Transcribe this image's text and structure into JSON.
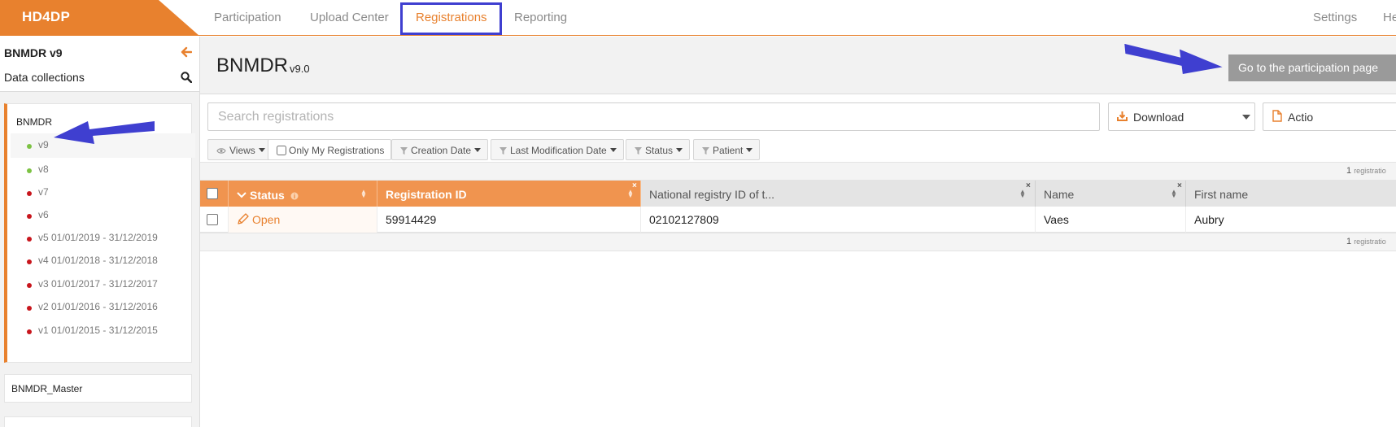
{
  "app": {
    "logo": "HD4DP"
  },
  "nav": {
    "items": [
      "Participation",
      "Upload Center",
      "Registrations",
      "Reporting"
    ],
    "right": [
      "Settings",
      "He"
    ]
  },
  "sidebar": {
    "title": "BNMDR v9",
    "subtitle": "Data collections",
    "groups": [
      {
        "name": "BNMDR",
        "versions": [
          {
            "label": "v9",
            "status": "green"
          },
          {
            "label": "v8",
            "status": "green"
          },
          {
            "label": "v7",
            "status": "red"
          },
          {
            "label": "v6",
            "status": "red"
          },
          {
            "label": "v5 01/01/2019 - 31/12/2019",
            "status": "red"
          },
          {
            "label": "v4 01/01/2018 - 31/12/2018",
            "status": "red"
          },
          {
            "label": "v3 01/01/2017 - 31/12/2017",
            "status": "red"
          },
          {
            "label": "v2 01/01/2016 - 31/12/2016",
            "status": "red"
          },
          {
            "label": "v1 01/01/2015 - 31/12/2015",
            "status": "red"
          }
        ]
      },
      {
        "name": "BNMDR_Master"
      }
    ]
  },
  "page": {
    "title": "BNMDR",
    "version": "v9.0",
    "participation_button": "Go to the participation page"
  },
  "toolbar": {
    "search_placeholder": "Search registrations",
    "download": "Download",
    "actions": "Actio"
  },
  "filters": {
    "views": "Views",
    "only_mine": "Only My Registrations",
    "creation_date": "Creation Date",
    "last_modification_date": "Last Modification Date",
    "status": "Status",
    "patient": "Patient"
  },
  "table": {
    "count_top": "1",
    "count_bottom": "1",
    "count_suffix": "registratio",
    "columns": [
      "Status",
      "Registration ID",
      "National registry ID of t...",
      "Name",
      "First name"
    ],
    "rows": [
      {
        "status": "Open",
        "registration_id": "59914429",
        "national_id": "02102127809",
        "name": "Vaes",
        "first_name": "Aubry"
      }
    ]
  },
  "colors": {
    "accent": "#e8812e",
    "annotation": "#3f3fd0",
    "ok": "#7cc243",
    "closed": "#c8161d"
  }
}
